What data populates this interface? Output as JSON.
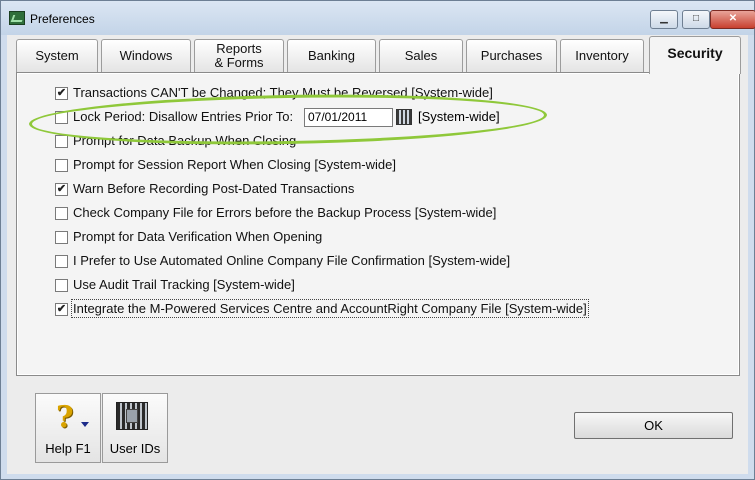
{
  "window": {
    "title": "Preferences",
    "minimize_label": "▁",
    "maximize_label": "□",
    "close_label": "✕"
  },
  "tabs": [
    {
      "label": "System"
    },
    {
      "label": "Windows"
    },
    {
      "label_line1": "Reports",
      "label_line2": "& Forms"
    },
    {
      "label": "Banking"
    },
    {
      "label": "Sales"
    },
    {
      "label": "Purchases"
    },
    {
      "label": "Inventory"
    },
    {
      "label": "Security",
      "active": true
    }
  ],
  "options": [
    {
      "label": "Transactions CAN'T be Changed; They Must be Reversed [System-wide]",
      "checked": true,
      "check_mark": "✔"
    },
    {
      "label": "Lock Period: Disallow Entries Prior To:",
      "checked": false,
      "date": "07/01/2011",
      "suffix": "[System-wide]"
    },
    {
      "label": "Prompt for Data Backup When Closing",
      "checked": false
    },
    {
      "label": "Prompt for Session Report When Closing [System-wide]",
      "checked": false
    },
    {
      "label": "Warn Before Recording Post-Dated Transactions",
      "checked": true,
      "check_mark": "✔"
    },
    {
      "label": "Check Company File for Errors before the Backup Process [System-wide]",
      "checked": false
    },
    {
      "label": "Prompt for Data Verification When Opening",
      "checked": false
    },
    {
      "label": "I Prefer to Use Automated Online Company File Confirmation [System-wide]",
      "checked": false
    },
    {
      "label": "Use Audit Trail Tracking [System-wide]",
      "checked": false
    },
    {
      "label": "Integrate the M-Powered Services Centre and AccountRight Company File [System-wide]",
      "checked": true,
      "check_mark": "✔"
    }
  ],
  "footer": {
    "help_label": "Help F1",
    "help_glyph": "?",
    "user_ids_label": "User IDs",
    "ok_label": "OK"
  },
  "colors": {
    "highlight_ring": "#8fc83a",
    "window_frame": "#cfdced"
  }
}
